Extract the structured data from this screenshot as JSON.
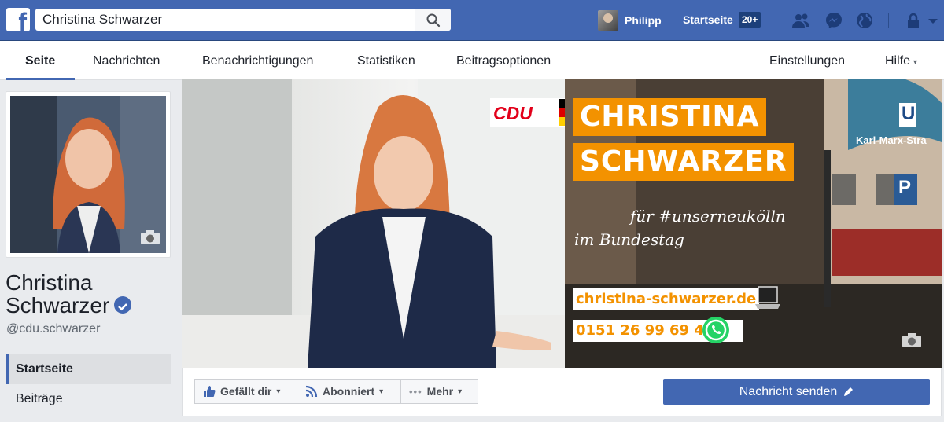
{
  "topbar": {
    "logo": "f",
    "search_value": "Christina Schwarzer",
    "user_name": "Philipp",
    "home_label": "Startseite",
    "home_badge": "20+",
    "icons": [
      "friends-icon",
      "messenger-icon",
      "globe-icon",
      "lock-icon",
      "chevron-down-icon"
    ]
  },
  "page_nav": {
    "tabs": [
      {
        "label": "Seite",
        "active": true
      },
      {
        "label": "Nachrichten"
      },
      {
        "label": "Benachrichtigungen"
      },
      {
        "label": "Statistiken"
      },
      {
        "label": "Beitragsoptionen"
      }
    ],
    "settings_label": "Einstellungen",
    "help_label": "Hilfe",
    "help_caret": "▾"
  },
  "profile": {
    "name_line1": "Christina",
    "name_line2": "Schwarzer",
    "handle": "@cdu.schwarzer",
    "verified": true
  },
  "sidebar": {
    "items": [
      {
        "label": "Startseite",
        "active": true
      },
      {
        "label": "Beiträge"
      }
    ]
  },
  "cover": {
    "party": "CDU",
    "name_line1": "CHRISTINA",
    "name_line2": "SCHWARZER",
    "tagline_line1": "für #unserneukölln",
    "tagline_line2": "im Bundestag",
    "website": "christina-schwarzer.de",
    "phone": "0151 26 99 69 48",
    "sign_u": "U",
    "sign_station": "Karl-Marx-Stra",
    "sign_p": "P",
    "accent_color": "#f39200"
  },
  "actions": {
    "like_label": "Gefällt dir",
    "follow_label": "Abonniert",
    "more_label": "Mehr",
    "message_label": "Nachricht senden",
    "caret": "▾"
  },
  "colors": {
    "brand_blue": "#4267b2",
    "cdu_red": "#e2001a"
  }
}
